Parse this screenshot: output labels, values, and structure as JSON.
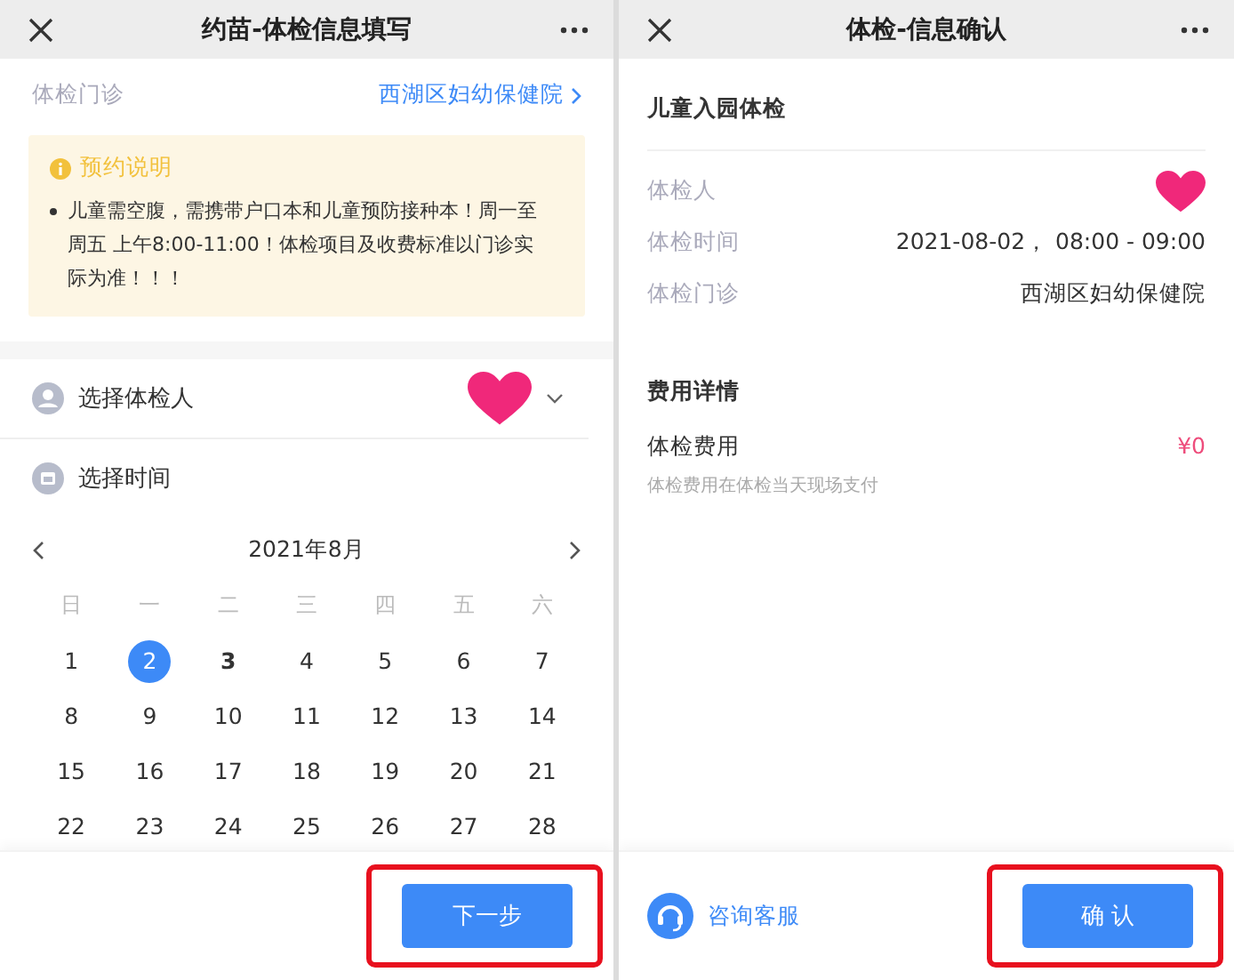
{
  "left": {
    "title": "约苗-体检信息填写",
    "clinic": {
      "label": "体检门诊",
      "value": "西湖区妇幼保健院"
    },
    "notice": {
      "title": "预约说明",
      "items": [
        "儿童需空腹，需携带户口本和儿童预防接种本！周一至周五 上午8:00-11:00！体检项目及收费标准以门诊实际为准！！！"
      ]
    },
    "person": {
      "label": "选择体检人"
    },
    "time": {
      "label": "选择时间"
    },
    "calendar": {
      "month": "2021年8月",
      "weekdays": [
        "日",
        "一",
        "二",
        "三",
        "四",
        "五",
        "六"
      ],
      "days": [
        {
          "day": "1",
          "selected": false,
          "disabled": true
        },
        {
          "day": "2",
          "selected": true,
          "disabled": false
        },
        {
          "day": "3",
          "selected": false,
          "disabled": false
        },
        {
          "day": "4",
          "selected": false,
          "disabled": true
        },
        {
          "day": "5",
          "selected": false,
          "disabled": true
        },
        {
          "day": "6",
          "selected": false,
          "disabled": true
        },
        {
          "day": "7",
          "selected": false,
          "disabled": true
        },
        {
          "day": "8",
          "selected": false,
          "disabled": true
        },
        {
          "day": "9",
          "selected": false,
          "disabled": true
        },
        {
          "day": "10",
          "selected": false,
          "disabled": true
        },
        {
          "day": "11",
          "selected": false,
          "disabled": true
        },
        {
          "day": "12",
          "selected": false,
          "disabled": true
        },
        {
          "day": "13",
          "selected": false,
          "disabled": true
        },
        {
          "day": "14",
          "selected": false,
          "disabled": true
        },
        {
          "day": "15",
          "selected": false,
          "disabled": true
        },
        {
          "day": "16",
          "selected": false,
          "disabled": true
        },
        {
          "day": "17",
          "selected": false,
          "disabled": true
        },
        {
          "day": "18",
          "selected": false,
          "disabled": true
        },
        {
          "day": "19",
          "selected": false,
          "disabled": true
        },
        {
          "day": "20",
          "selected": false,
          "disabled": true
        },
        {
          "day": "21",
          "selected": false,
          "disabled": true
        },
        {
          "day": "22",
          "selected": false,
          "disabled": true
        },
        {
          "day": "23",
          "selected": false,
          "disabled": true
        },
        {
          "day": "24",
          "selected": false,
          "disabled": true
        },
        {
          "day": "25",
          "selected": false,
          "disabled": true
        },
        {
          "day": "26",
          "selected": false,
          "disabled": true
        },
        {
          "day": "27",
          "selected": false,
          "disabled": true
        },
        {
          "day": "28",
          "selected": false,
          "disabled": true
        }
      ]
    },
    "next_button": "下一步"
  },
  "right": {
    "title": "体检-信息确认",
    "section_title": "儿童入园体检",
    "rows": [
      {
        "label": "体检人"
      },
      {
        "label": "体检时间",
        "value": "2021-08-02，  08:00 - 09:00"
      },
      {
        "label": "体检门诊",
        "value": "西湖区妇幼保健院"
      }
    ],
    "fee": {
      "title": "费用详情",
      "label": "体检费用",
      "value": "¥0",
      "note": "体检费用在体检当天现场支付"
    },
    "service_link": "咨询客服",
    "confirm_button": "确 认"
  }
}
